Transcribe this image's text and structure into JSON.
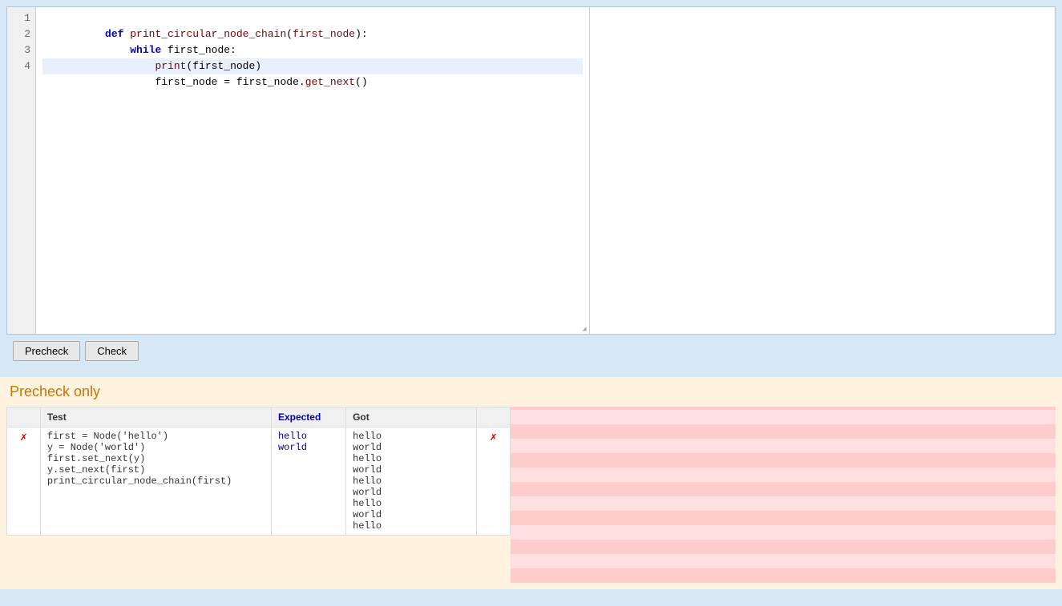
{
  "editor": {
    "lines": [
      {
        "number": "1",
        "tokens": [
          {
            "type": "kw",
            "text": "def "
          },
          {
            "type": "fn",
            "text": "print_circular_node_chain"
          },
          {
            "type": "punct",
            "text": "("
          },
          {
            "type": "param",
            "text": "first_node"
          },
          {
            "type": "punct",
            "text": "):"
          }
        ],
        "active": false
      },
      {
        "number": "2",
        "tokens": [
          {
            "type": "indent",
            "text": "    "
          },
          {
            "type": "kw",
            "text": "while "
          },
          {
            "type": "var",
            "text": "first_node:"
          }
        ],
        "active": false
      },
      {
        "number": "3",
        "tokens": [
          {
            "type": "indent",
            "text": "        "
          },
          {
            "type": "builtin",
            "text": "print"
          },
          {
            "type": "punct",
            "text": "("
          },
          {
            "type": "var",
            "text": "first_node"
          },
          {
            "type": "punct",
            "text": ")"
          }
        ],
        "active": false
      },
      {
        "number": "4",
        "tokens": [
          {
            "type": "indent",
            "text": "        "
          },
          {
            "type": "var",
            "text": "first_node "
          },
          {
            "type": "punct",
            "text": "= "
          },
          {
            "type": "var",
            "text": "first_node"
          },
          {
            "type": "punct",
            "text": "."
          },
          {
            "type": "fn",
            "text": "get_next"
          },
          {
            "type": "punct",
            "text": "()"
          }
        ],
        "active": true
      }
    ]
  },
  "toolbar": {
    "precheck_label": "Precheck",
    "check_label": "Check"
  },
  "precheck": {
    "title": "Precheck only",
    "table": {
      "headers": [
        "",
        "Test",
        "Expected",
        "Got",
        ""
      ],
      "rows": [
        {
          "icon": "✗",
          "test_lines": [
            "first = Node('hello')",
            "y = Node('world')",
            "first.set_next(y)",
            "y.set_next(first)",
            "print_circular_node_chain(first)"
          ],
          "expected_lines": [
            "hello",
            "world"
          ],
          "got_lines": [
            "hello",
            "world",
            "hello",
            "world",
            "hello",
            "world",
            "hello",
            "world",
            "hello"
          ],
          "action_icon": "✗"
        }
      ]
    }
  }
}
